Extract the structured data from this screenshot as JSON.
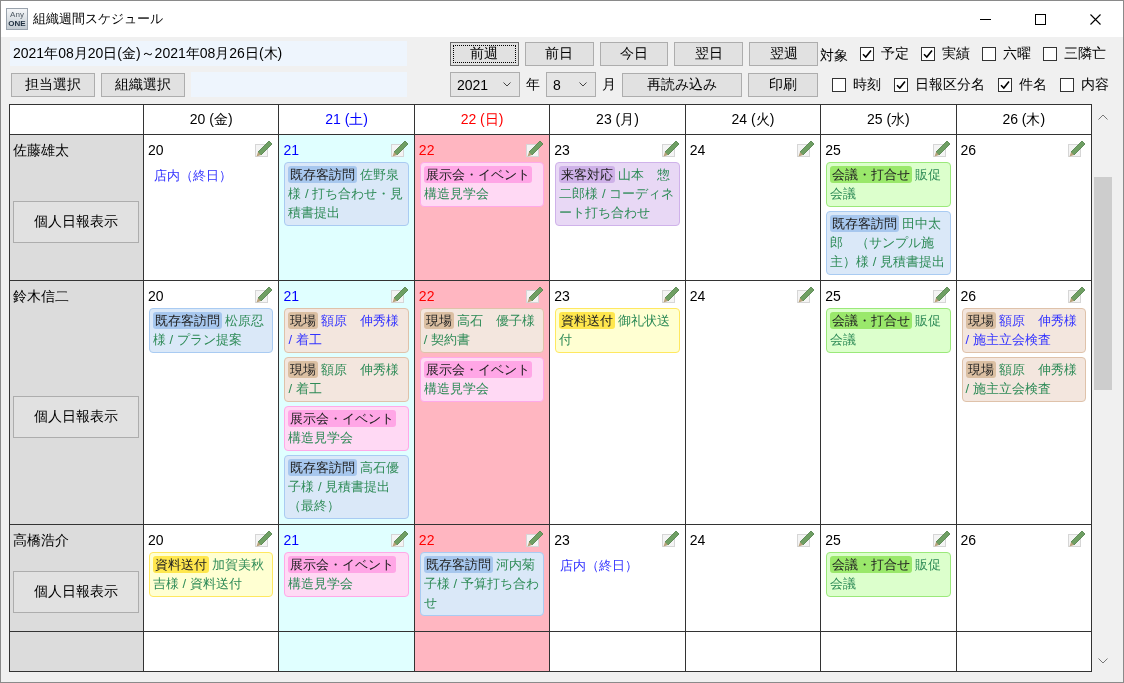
{
  "window": {
    "title": "組織週間スケジュール",
    "logo_text": [
      "Any",
      "ONE"
    ]
  },
  "toolbar": {
    "date_range": "2021年08月20日(金)～2021年08月26日(木)",
    "nav_buttons": [
      {
        "label": "前週",
        "focused": true
      },
      {
        "label": "前日",
        "focused": false
      },
      {
        "label": "今日",
        "focused": false
      },
      {
        "label": "翌日",
        "focused": false
      },
      {
        "label": "翌週",
        "focused": false
      }
    ],
    "target_label": "対象",
    "filters_row1": [
      {
        "label": "予定",
        "checked": true
      },
      {
        "label": "実績",
        "checked": true
      },
      {
        "label": "六曜",
        "checked": false
      },
      {
        "label": "三隣亡",
        "checked": false
      }
    ],
    "select_buttons": [
      "担当選択",
      "組織選択"
    ],
    "year": {
      "value": "2021",
      "unit": "年"
    },
    "month": {
      "value": "8",
      "unit": "月"
    },
    "action_buttons": [
      "再読み込み",
      "印刷"
    ],
    "filters_row2": [
      {
        "label": "時刻",
        "checked": false
      },
      {
        "label": "日報区分名",
        "checked": true
      },
      {
        "label": "件名",
        "checked": true
      },
      {
        "label": "内容",
        "checked": false
      }
    ]
  },
  "days": [
    {
      "label": "20 (金)",
      "kind": "weekday"
    },
    {
      "label": "21 (土)",
      "kind": "saturday"
    },
    {
      "label": "22 (日)",
      "kind": "sunday"
    },
    {
      "label": "23 (月)",
      "kind": "weekday"
    },
    {
      "label": "24 (火)",
      "kind": "weekday"
    },
    {
      "label": "25 (水)",
      "kind": "weekday"
    },
    {
      "label": "26 (木)",
      "kind": "weekday"
    }
  ],
  "staff": [
    {
      "name": "佐藤雄太",
      "report_button": "個人日報表示",
      "cells": [
        {
          "day": "20",
          "events": [
            {
              "kind": "note",
              "title": "店内（終日）",
              "color": "#3333ff"
            }
          ]
        },
        {
          "day": "21",
          "events": [
            {
              "kind": "visit",
              "category": "既存客訪問",
              "title": "佐野泉様 / 打ち合わせ・見積書提出",
              "color": "#2e8b57"
            }
          ]
        },
        {
          "day": "22",
          "events": [
            {
              "kind": "exhibit",
              "category": "展示会・イベント",
              "title": "構造見学会",
              "color": "#2e8b57"
            }
          ]
        },
        {
          "day": "23",
          "events": [
            {
              "kind": "guest",
              "category": "来客対応",
              "title": "山本　惣二郎様 / コーディネート打ち合わせ",
              "color": "#2e8b57"
            }
          ]
        },
        {
          "day": "24"
        },
        {
          "day": "25",
          "events": [
            {
              "kind": "meeting",
              "category": "会議・打合せ",
              "title": "販促会議",
              "color": "#2e8b57"
            },
            {
              "kind": "visit",
              "category": "既存客訪問",
              "title": "田中太郎　（サンプル施主）様 / 見積書提出",
              "color": "#2e8b57"
            }
          ]
        },
        {
          "day": "26"
        }
      ]
    },
    {
      "name": "鈴木信二",
      "report_button": "個人日報表示",
      "cells": [
        {
          "day": "20",
          "events": [
            {
              "kind": "visit",
              "category": "既存客訪問",
              "title": "松原忍様 / プラン提案",
              "color": "#2e8b57"
            }
          ]
        },
        {
          "day": "21",
          "events": [
            {
              "kind": "site",
              "category": "現場",
              "title": "額原　伸秀様 / 着工",
              "color": "#3333ff"
            },
            {
              "kind": "site",
              "category": "現場",
              "title": "額原　伸秀様 / 着工",
              "color": "#2e8b57"
            },
            {
              "kind": "exhibit",
              "category": "展示会・イベント",
              "title": "構造見学会",
              "color": "#2e8b57"
            },
            {
              "kind": "visit",
              "category": "既存客訪問",
              "title": "高石優子様 / 見積書提出（最終）",
              "color": "#2e8b57"
            }
          ]
        },
        {
          "day": "22",
          "events": [
            {
              "kind": "site",
              "category": "現場",
              "title": "高石　優子様 / 契約書",
              "color": "#2e8b57"
            },
            {
              "kind": "exhibit",
              "category": "展示会・イベント",
              "title": "構造見学会",
              "color": "#2e8b57"
            }
          ]
        },
        {
          "day": "23",
          "events": [
            {
              "kind": "document",
              "category": "資料送付",
              "title": "御礼状送付",
              "color": "#2e8b57"
            }
          ]
        },
        {
          "day": "24"
        },
        {
          "day": "25",
          "events": [
            {
              "kind": "meeting",
              "category": "会議・打合せ",
              "title": "販促会議",
              "color": "#2e8b57"
            }
          ]
        },
        {
          "day": "26",
          "events": [
            {
              "kind": "site",
              "category": "現場",
              "title": "額原　伸秀様 / 施主立会検査",
              "color": "#3333ff"
            },
            {
              "kind": "site",
              "category": "現場",
              "title": "額原　伸秀様 / 施主立会検査",
              "color": "#2e8b57"
            }
          ]
        }
      ]
    },
    {
      "name": "高橋浩介",
      "report_button": "個人日報表示",
      "cells": [
        {
          "day": "20",
          "events": [
            {
              "kind": "document",
              "category": "資料送付",
              "title": "加賀美秋吉様 / 資料送付",
              "color": "#2e8b57"
            }
          ]
        },
        {
          "day": "21",
          "events": [
            {
              "kind": "exhibit",
              "category": "展示会・イベント",
              "title": "構造見学会",
              "color": "#2e8b57"
            }
          ]
        },
        {
          "day": "22",
          "events": [
            {
              "kind": "visit",
              "category": "既存客訪問",
              "title": "河内菊子様 / 予算打ち合わせ",
              "color": "#2e8b57"
            }
          ]
        },
        {
          "day": "23",
          "events": [
            {
              "kind": "note",
              "title": "店内（終日）",
              "color": "#3333ff"
            }
          ]
        },
        {
          "day": "24"
        },
        {
          "day": "25",
          "events": [
            {
              "kind": "meeting",
              "category": "会議・打合せ",
              "title": "販促会議",
              "color": "#2e8b57"
            }
          ]
        },
        {
          "day": "26"
        }
      ]
    }
  ]
}
